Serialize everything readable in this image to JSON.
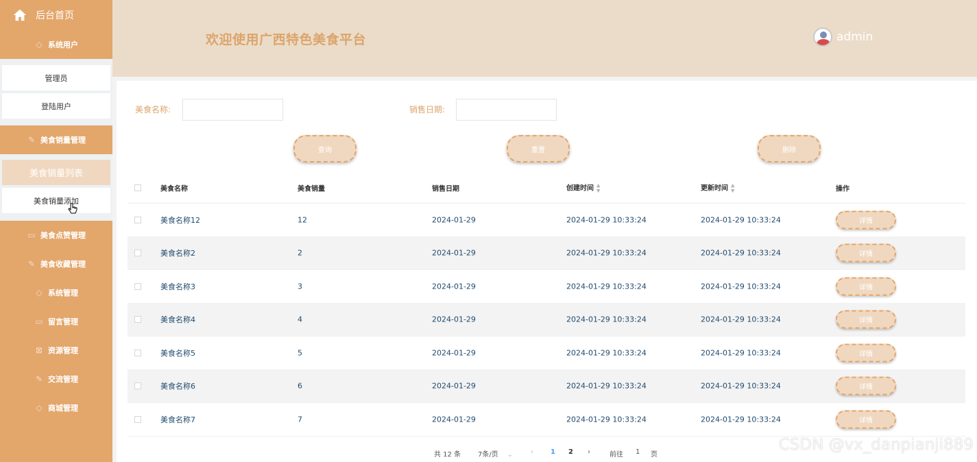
{
  "sidebar": {
    "home_label": "后台首页",
    "menus": [
      {
        "label": "系统用户"
      },
      {
        "label": "美食销量管理"
      },
      {
        "label": "美食点赞管理"
      },
      {
        "label": "美食收藏管理"
      },
      {
        "label": "系统管理"
      },
      {
        "label": "留言管理"
      },
      {
        "label": "资源管理"
      },
      {
        "label": "交流管理"
      },
      {
        "label": "商城管理"
      }
    ],
    "sub_system_users": [
      "管理员",
      "登陆用户"
    ],
    "sub_sales": [
      "美食销量列表",
      "美食销量添加"
    ]
  },
  "header": {
    "title": "欢迎使用广西特色美食平台",
    "username": "admin"
  },
  "search": {
    "name_label": "美食名称:",
    "date_label": "销售日期:",
    "query_btn": "查询",
    "reset_btn": "重置",
    "delete_btn": "删除"
  },
  "table": {
    "headers": [
      "美食名称",
      "美食销量",
      "销售日期",
      "创建时间",
      "更新时间",
      "操作"
    ],
    "detail_label": "详情",
    "rows": [
      [
        "美食名称12",
        "12",
        "2024-01-29",
        "2024-01-29 10:33:24",
        "2024-01-29 10:33:24"
      ],
      [
        "美食名称2",
        "2",
        "2024-01-29",
        "2024-01-29 10:33:24",
        "2024-01-29 10:33:24"
      ],
      [
        "美食名称3",
        "3",
        "2024-01-29",
        "2024-01-29 10:33:24",
        "2024-01-29 10:33:24"
      ],
      [
        "美食名称4",
        "4",
        "2024-01-29",
        "2024-01-29 10:33:24",
        "2024-01-29 10:33:24"
      ],
      [
        "美食名称5",
        "5",
        "2024-01-29",
        "2024-01-29 10:33:24",
        "2024-01-29 10:33:24"
      ],
      [
        "美食名称6",
        "6",
        "2024-01-29",
        "2024-01-29 10:33:24",
        "2024-01-29 10:33:24"
      ],
      [
        "美食名称7",
        "7",
        "2024-01-29",
        "2024-01-29 10:33:24",
        "2024-01-29 10:33:24"
      ]
    ]
  },
  "pager": {
    "total": "共 12 条",
    "page_size": "7条/页",
    "pages": [
      "1",
      "2"
    ],
    "current": "1",
    "goto_prefix": "前往",
    "goto_value": "1",
    "goto_suffix": "页"
  },
  "watermark": "CSDN @vx_danpianji889",
  "colors": {
    "accent": "#e3a66b",
    "header_bg": "#ebdcc9",
    "title": "#dca46b"
  }
}
